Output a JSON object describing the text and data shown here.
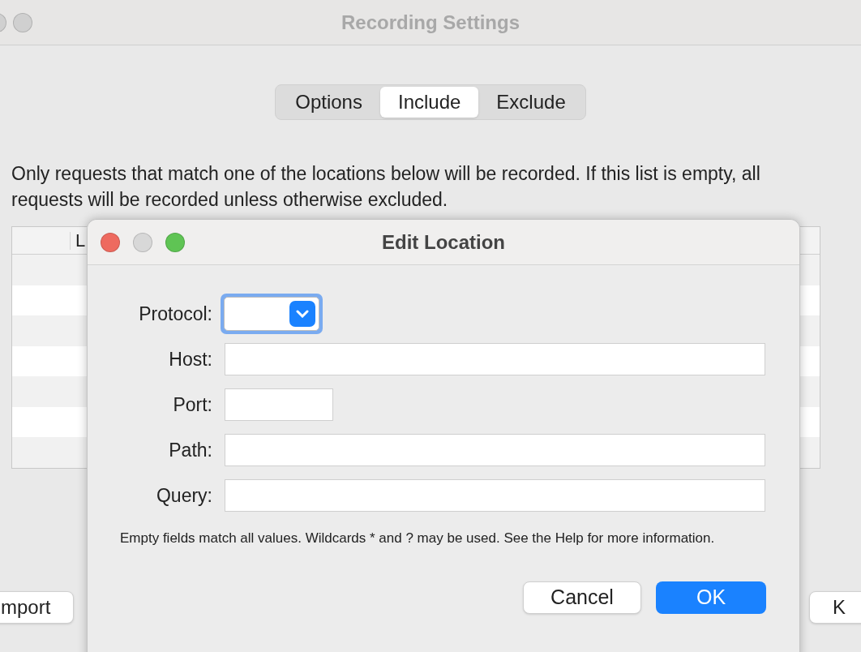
{
  "background_window": {
    "title": "Recording Settings",
    "tabs": [
      {
        "label": "Options",
        "selected": false
      },
      {
        "label": "Include",
        "selected": true
      },
      {
        "label": "Exclude",
        "selected": false
      }
    ],
    "description": "Only requests that match one of the locations below will be recorded. If this list is empty, all requests will be recorded unless otherwise excluded.",
    "table": {
      "columns": [
        "L"
      ]
    },
    "buttons": [
      "mport",
      "K"
    ]
  },
  "dialog": {
    "title": "Edit Location",
    "fields": [
      {
        "label": "Protocol:",
        "kind": "select"
      },
      {
        "label": "Host:",
        "kind": "text"
      },
      {
        "label": "Port:",
        "kind": "short"
      },
      {
        "label": "Path:",
        "kind": "text"
      },
      {
        "label": "Query:",
        "kind": "text"
      }
    ],
    "hint": "Empty fields match all values. Wildcards * and ? may be used. See the Help for more information.",
    "buttons": [
      {
        "label": "Cancel",
        "default": false
      },
      {
        "label": "OK",
        "default": true
      }
    ]
  }
}
